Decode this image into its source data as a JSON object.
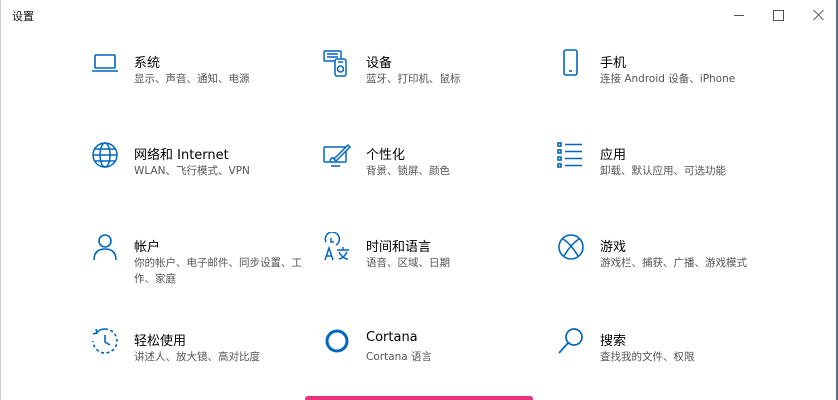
{
  "window": {
    "title": "设置",
    "accent": "#0067c0"
  },
  "tiles": [
    {
      "name": "系统",
      "desc": "显示、声音、通知、电源",
      "icon": "laptop-icon"
    },
    {
      "name": "设备",
      "desc": "蓝牙、打印机、鼠标",
      "icon": "devices-icon"
    },
    {
      "name": "手机",
      "desc": "连接 Android 设备、iPhone",
      "icon": "phone-icon"
    },
    {
      "name": "网络和 Internet",
      "desc": "WLAN、飞行模式、VPN",
      "icon": "globe-icon"
    },
    {
      "name": "个性化",
      "desc": "背景、锁屏、颜色",
      "icon": "personalization-icon"
    },
    {
      "name": "应用",
      "desc": "卸载、默认应用、可选功能",
      "icon": "apps-list-icon"
    },
    {
      "name": "帐户",
      "desc": "你的帐户、电子邮件、同步设置、工作、家庭",
      "icon": "person-icon"
    },
    {
      "name": "时间和语言",
      "desc": "语音、区域、日期",
      "icon": "time-language-icon"
    },
    {
      "name": "游戏",
      "desc": "游戏栏、捕获、广播、游戏模式",
      "icon": "xbox-icon"
    },
    {
      "name": "轻松使用",
      "desc": "讲述人、放大镜、高对比度",
      "icon": "ease-of-access-icon"
    },
    {
      "name": "Cortana",
      "desc": "Cortana 语言",
      "icon": "cortana-icon"
    },
    {
      "name": "搜索",
      "desc": "查找我的文件、权限",
      "icon": "search-icon"
    }
  ]
}
